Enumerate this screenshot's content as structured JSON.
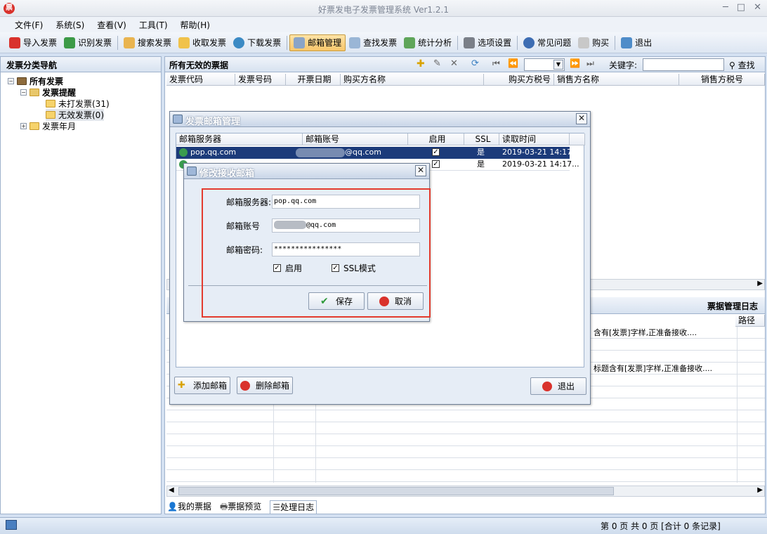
{
  "window": {
    "title": "好票发电子发票管理系统 Ver1.2.1",
    "minimize": "─",
    "maximize": "□",
    "close": "✕"
  },
  "menu": [
    "文件(F)",
    "系统(S)",
    "查看(V)",
    "工具(T)",
    "帮助(H)"
  ],
  "toolbar": {
    "import": "导入发票",
    "recognize": "识别发票",
    "search": "搜索发票",
    "receive": "收取发票",
    "download": "下载发票",
    "mailbox": "邮箱管理",
    "find": "查找发票",
    "stats": "统计分析",
    "options": "选项设置",
    "faq": "常见问题",
    "buy": "购买",
    "exit": "退出"
  },
  "nav": {
    "title": "发票分类导航",
    "root": "所有发票",
    "reminder": "发票提醒",
    "unprinted": "未打发票(31)",
    "invalid": "无效发票(0)",
    "yearmonth": "发票年月",
    "expand_minus": "−",
    "expand_plus": "+"
  },
  "main": {
    "title": "所有无效的票据",
    "keyword_label": "关键字:",
    "search_btn": "查找",
    "columns": [
      "发票代码",
      "发票号码",
      "开票日期",
      "购买方名称",
      "购买方税号",
      "销售方名称",
      "销售方税号"
    ]
  },
  "log": {
    "title": "票据管理日志",
    "path_col": "路径",
    "rows": [
      "含有[发票]字样,正准备接收....",
      "标题含有[发票]字样,正准备接收...."
    ]
  },
  "bottom_tabs": [
    "我的票据",
    "票据预览",
    "处理日志"
  ],
  "status": {
    "pages": "第 0 页 共 0 页 [合计 0 条记录]"
  },
  "mailbox_dialog": {
    "title": "发票邮箱管理",
    "columns": [
      "邮箱服务器",
      "邮箱账号",
      "启用",
      "SSL",
      "读取时间"
    ],
    "rows": [
      {
        "server": "pop.qq.com",
        "account": "@qq.com",
        "ssl": "是",
        "time": "2019-03-21 14:17..."
      },
      {
        "server": "",
        "account": "",
        "ssl": "是",
        "time": "2019-03-21 14:17..."
      }
    ],
    "add_btn": "添加邮箱",
    "delete_btn": "删除邮箱",
    "exit_btn": "退出"
  },
  "edit_dialog": {
    "title": "修改接收邮箱",
    "server_label": "邮箱服务器:",
    "server_value": "pop.qq.com",
    "account_label": "邮箱账号",
    "account_value": "@qq.com",
    "password_label": "邮箱密码:",
    "password_value": "****************",
    "enable_label": "启用",
    "ssl_label": "SSL模式",
    "save_btn": "保存",
    "cancel_btn": "取消"
  },
  "colors": {
    "highlight": "#e33b2e",
    "selection": "#1c3b7a"
  }
}
